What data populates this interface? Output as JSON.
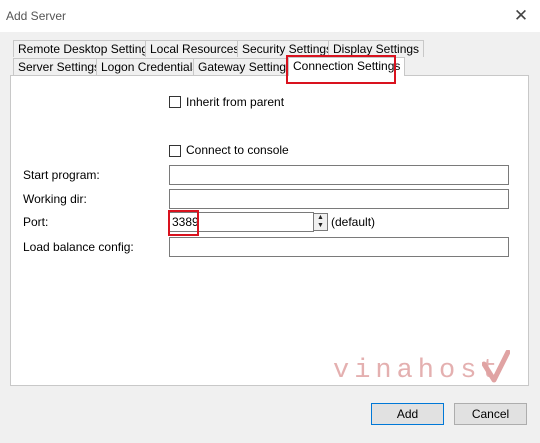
{
  "window": {
    "title": "Add Server",
    "close_symbol": "✕"
  },
  "tabs_row_top": [
    {
      "label": "Remote Desktop Settings"
    },
    {
      "label": "Local Resources"
    },
    {
      "label": "Security Settings"
    },
    {
      "label": "Display Settings"
    }
  ],
  "tabs_row_bottom": [
    {
      "label": "Server Settings"
    },
    {
      "label": "Logon Credentials"
    },
    {
      "label": "Gateway Settings"
    },
    {
      "label": "Connection Settings",
      "active": true
    }
  ],
  "form": {
    "inherit_label": "Inherit from parent",
    "inherit_checked": false,
    "console_label": "Connect to console",
    "console_checked": false,
    "start_program_label": "Start program:",
    "start_program_value": "",
    "working_dir_label": "Working dir:",
    "working_dir_value": "",
    "port_label": "Port:",
    "port_value": "3389",
    "port_note": "(default)",
    "load_balance_label": "Load balance config:",
    "load_balance_value": ""
  },
  "buttons": {
    "add": "Add",
    "cancel": "Cancel"
  },
  "watermark": {
    "text": "vinahost",
    "icon": "check-mark-icon"
  },
  "colors": {
    "highlight": "#d9121e",
    "primary_border": "#0078d7",
    "dialog_bg": "#f0f0f0"
  }
}
